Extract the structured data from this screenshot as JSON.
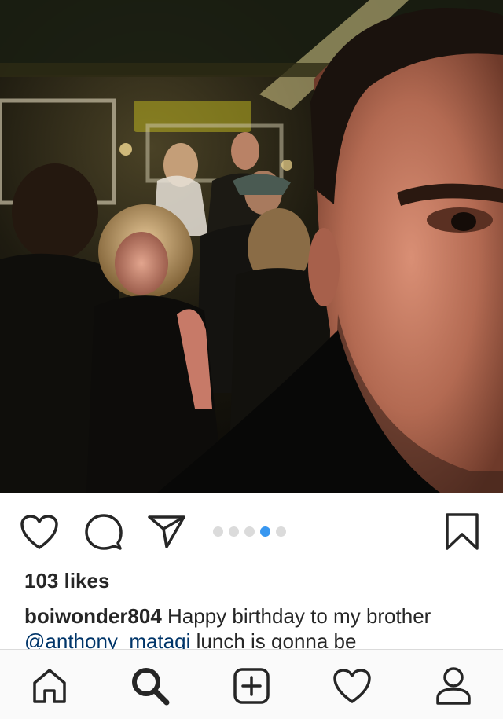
{
  "post": {
    "likes_text": "103 likes",
    "caption_user": "boiwonder804",
    "caption_text_1": " Happy birthday to my brother ",
    "caption_mention": "@anthony_mataqi",
    "caption_text_2": " lunch is gonna be"
  },
  "carousel": {
    "total": 5,
    "active_index": 3,
    "active_color": "#3897f0",
    "inactive_color": "#dbdbdb"
  },
  "actions": {
    "like_icon": "heart-outline-icon",
    "comment_icon": "speech-bubble-icon",
    "share_icon": "paper-plane-icon",
    "save_icon": "bookmark-outline-icon"
  },
  "tab_bar": {
    "tabs": [
      "home-icon",
      "search-icon",
      "new-post-icon",
      "activity-heart-icon",
      "profile-icon"
    ],
    "selected": "search-icon"
  }
}
